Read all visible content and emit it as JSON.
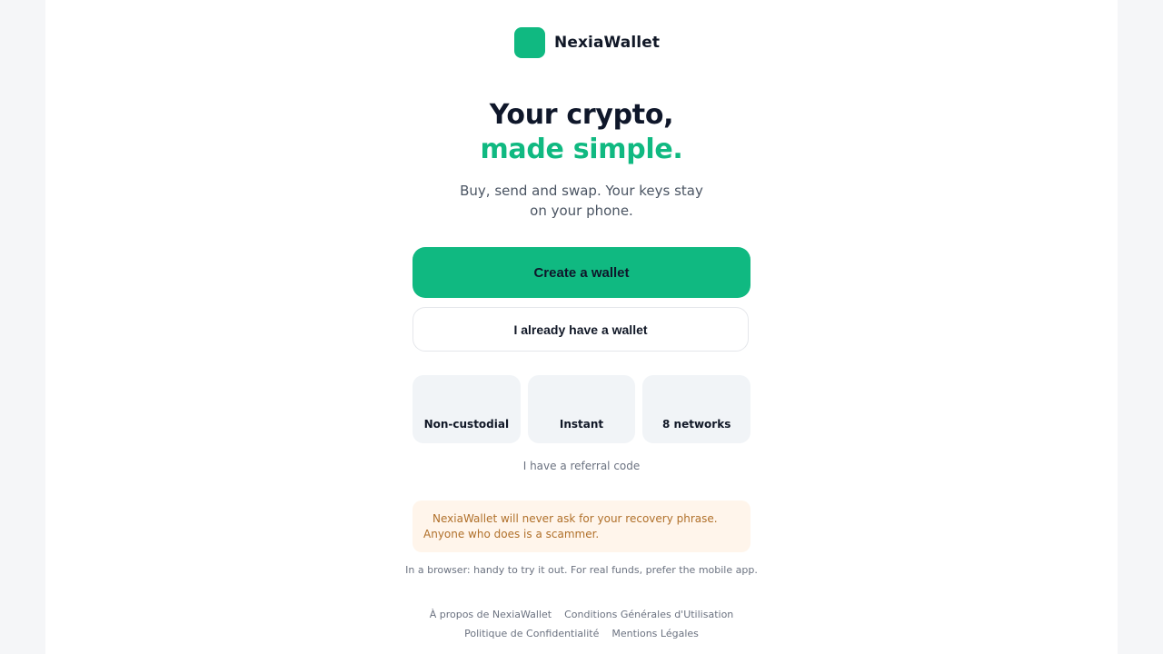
{
  "brand": {
    "name": "NexiaWallet",
    "accent_color": "#10b981"
  },
  "hero": {
    "title_line1": "Your crypto,",
    "title_line2": "made simple.",
    "subtitle": "Buy, send and swap. Your keys stay on your phone."
  },
  "actions": {
    "create_label": "Create a wallet",
    "import_label": "I already have a wallet",
    "referral_label": "I have a referral code"
  },
  "features": [
    {
      "label": "Non-custodial"
    },
    {
      "label": "Instant"
    },
    {
      "label": "8 networks"
    }
  ],
  "warning": {
    "text": "NexiaWallet will never ask for your recovery phrase. Anyone who does is a scammer."
  },
  "browser_note": "In a browser: handy to try it out. For real funds, prefer the mobile app.",
  "footer": {
    "links": [
      {
        "label": "À propos de NexiaWallet"
      },
      {
        "label": "Conditions Générales d'Utilisation"
      },
      {
        "label": "Politique de Confidentialité"
      },
      {
        "label": "Mentions Légales"
      }
    ]
  }
}
